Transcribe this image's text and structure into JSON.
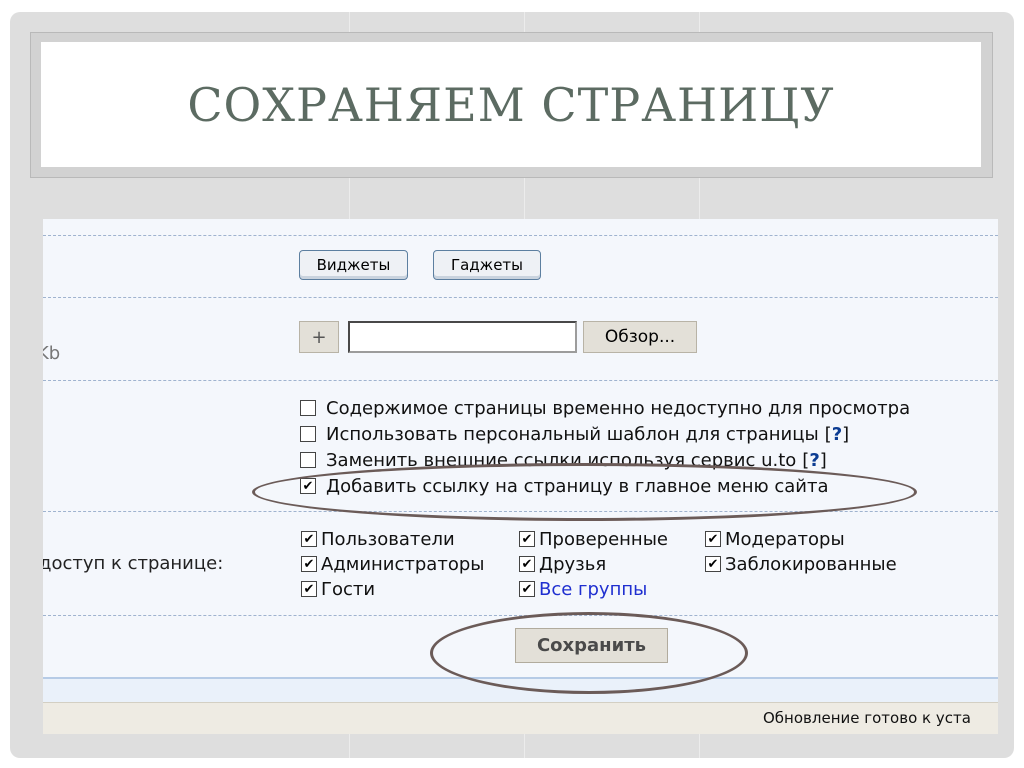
{
  "slide": {
    "title": "СОХРАНЯЕМ СТРАНИЦУ"
  },
  "screenshot": {
    "tabs": [
      {
        "label": "Виджеты"
      },
      {
        "label": "Гаджеты"
      }
    ],
    "upload": {
      "size_label_fragment": "Kb",
      "plus_label": "+",
      "file_value": "",
      "browse_label": "Обзор..."
    },
    "options": [
      {
        "label": "Содержимое страницы временно недоступно для просмотра",
        "checked": false,
        "help": ""
      },
      {
        "label": "Использовать персональный шаблон для страницы",
        "checked": false,
        "help": "?"
      },
      {
        "label": "Заменить внешние ссылки используя сервис u.to",
        "checked": false,
        "help": "?"
      },
      {
        "label": "Добавить ссылку на страницу в главное меню сайта",
        "checked": true,
        "help": ""
      }
    ],
    "access": {
      "label": "доступ к странице:",
      "groups": [
        {
          "label": "Пользователи",
          "checked": true
        },
        {
          "label": "Проверенные",
          "checked": true
        },
        {
          "label": "Модераторы",
          "checked": true
        },
        {
          "label": "Администраторы",
          "checked": true
        },
        {
          "label": "Друзья",
          "checked": true
        },
        {
          "label": "Заблокированные",
          "checked": true
        },
        {
          "label": "Гости",
          "checked": true
        },
        {
          "label": "Все группы",
          "checked": true
        }
      ]
    },
    "save_label": "Сохранить",
    "status_text": "Обновление готово к уста",
    "colors": {
      "highlight_oval": "#6b5b58",
      "link": "#1f2fd0",
      "title": "#5c6b62"
    },
    "checkmark_glyph": "✔"
  }
}
